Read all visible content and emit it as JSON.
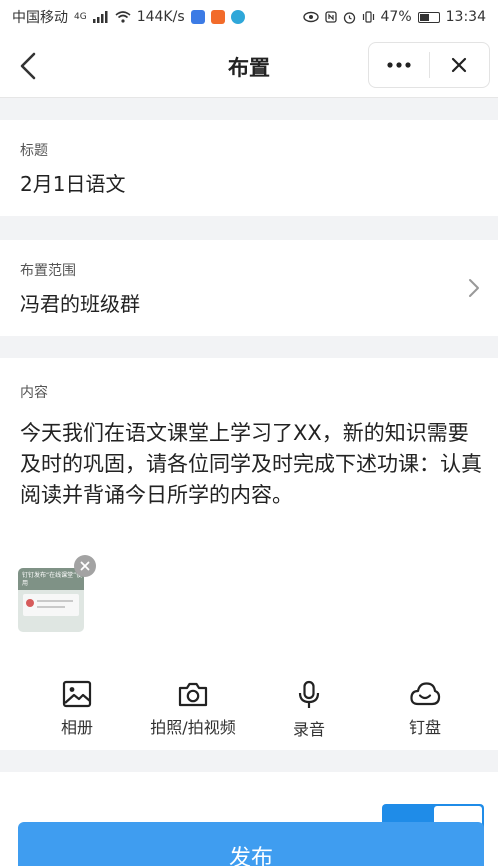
{
  "status_bar": {
    "carrier": "中国移动",
    "network_badge": "4G",
    "speed": "144K/s",
    "battery": "47%",
    "battery_level": 0.47,
    "time": "13:34"
  },
  "header": {
    "title": "布置",
    "back_icon": "chevron-left-icon",
    "more_icon": "more-dots-icon",
    "close_icon": "close-icon"
  },
  "form": {
    "title_label": "标题",
    "title_value": "2月1日语文",
    "scope_label": "布置范围",
    "scope_value": "冯君的班级群",
    "content_label": "内容",
    "content_text": "今天我们在语文课堂上学习了XX，新的知识需要及时的巩固，请各位同学及时完成下述功课：认真阅读并背诵今日所学的内容。"
  },
  "attachment": {
    "caption": "钉钉发布“在线课堂”使用"
  },
  "toolbar": {
    "items": [
      {
        "label": "相册",
        "icon": "image-icon"
      },
      {
        "label": "拍照/拍视频",
        "icon": "camera-icon"
      },
      {
        "label": "录音",
        "icon": "microphone-icon"
      },
      {
        "label": "钉盘",
        "icon": "cloud-drive-icon"
      }
    ]
  },
  "footer": {
    "publish_label": "发布"
  },
  "colors": {
    "accent": "#3f9df0",
    "background": "#f2f3f5"
  }
}
